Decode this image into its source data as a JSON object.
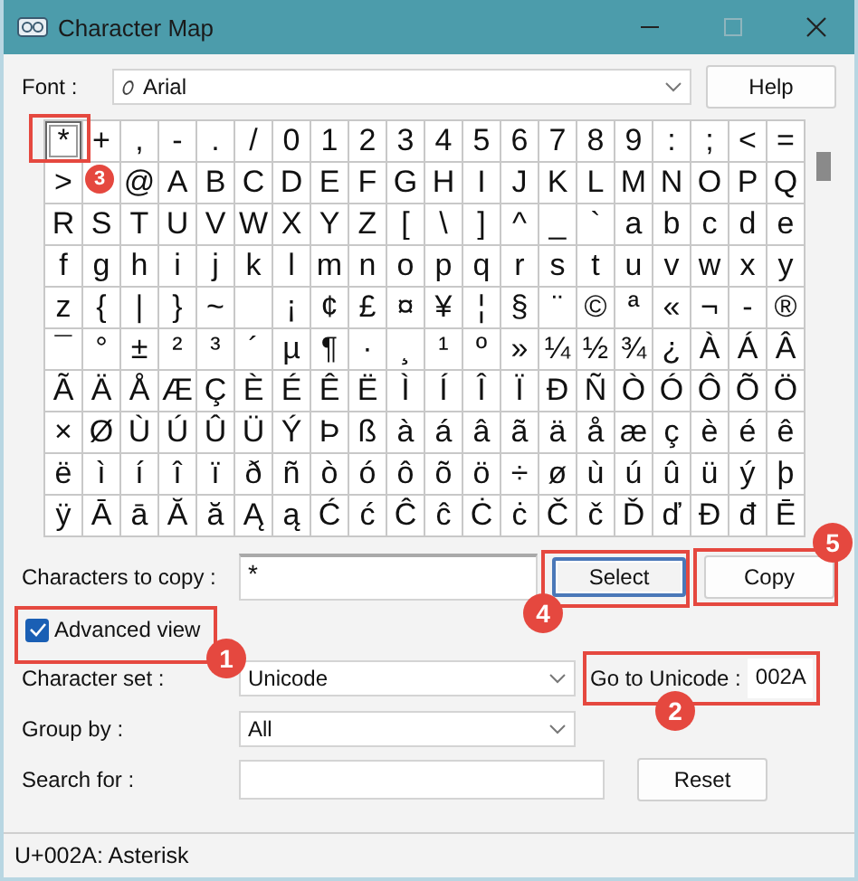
{
  "window": {
    "title": "Character Map"
  },
  "font": {
    "label": "Font :",
    "value": "Arial"
  },
  "help_button": {
    "label": "Help",
    "focused": false
  },
  "grid": [
    [
      {
        "char": "*",
        "selected": true,
        "callout": "3"
      },
      {
        "char": "+",
        "selected": false
      },
      {
        "char": ",",
        "selected": false
      },
      {
        "char": "-",
        "selected": false
      },
      {
        "char": ".",
        "selected": false
      },
      {
        "char": "/",
        "selected": false
      },
      {
        "char": "0",
        "selected": false
      },
      {
        "char": "1",
        "selected": false
      },
      {
        "char": "2",
        "selected": false
      },
      {
        "char": "3",
        "selected": false
      },
      {
        "char": "4",
        "selected": false
      },
      {
        "char": "5",
        "selected": false
      },
      {
        "char": "6",
        "selected": false
      },
      {
        "char": "7",
        "selected": false
      },
      {
        "char": "8",
        "selected": false
      },
      {
        "char": "9",
        "selected": false
      },
      {
        "char": ":",
        "selected": false
      },
      {
        "char": ";",
        "selected": false
      },
      {
        "char": "<",
        "selected": false
      },
      {
        "char": "=",
        "selected": false
      }
    ],
    [
      {
        "char": ">",
        "selected": false
      },
      {
        "selected": false
      },
      {
        "char": "@",
        "selected": false
      },
      {
        "char": "A",
        "selected": false
      },
      {
        "char": "B",
        "selected": false
      },
      {
        "char": "C",
        "selected": false
      },
      {
        "char": "D",
        "selected": false
      },
      {
        "char": "E",
        "selected": false
      },
      {
        "char": "F",
        "selected": false
      },
      {
        "char": "G",
        "selected": false
      },
      {
        "char": "H",
        "selected": false
      },
      {
        "char": "I",
        "selected": false
      },
      {
        "char": "J",
        "selected": false
      },
      {
        "char": "K",
        "selected": false
      },
      {
        "char": "L",
        "selected": false
      },
      {
        "char": "M",
        "selected": false
      },
      {
        "char": "N",
        "selected": false
      },
      {
        "char": "O",
        "selected": false
      },
      {
        "char": "P",
        "selected": false
      },
      {
        "char": "Q",
        "selected": false
      }
    ],
    [
      {
        "char": "R",
        "selected": false
      },
      {
        "char": "S",
        "selected": false
      },
      {
        "char": "T",
        "selected": false
      },
      {
        "char": "U",
        "selected": false
      },
      {
        "char": "V",
        "selected": false
      },
      {
        "char": "W",
        "selected": false
      },
      {
        "char": "X",
        "selected": false
      },
      {
        "char": "Y",
        "selected": false
      },
      {
        "char": "Z",
        "selected": false
      },
      {
        "char": "[",
        "selected": false
      },
      {
        "char": "\\",
        "selected": false
      },
      {
        "char": "]",
        "selected": false
      },
      {
        "char": "^",
        "selected": false
      },
      {
        "char": "_",
        "selected": false
      },
      {
        "char": "`",
        "selected": false
      },
      {
        "char": "a",
        "selected": false
      },
      {
        "char": "b",
        "selected": false
      },
      {
        "char": "c",
        "selected": false
      },
      {
        "char": "d",
        "selected": false
      },
      {
        "char": "e",
        "selected": false
      }
    ],
    [
      {
        "char": "f",
        "selected": false
      },
      {
        "char": "g",
        "selected": false
      },
      {
        "char": "h",
        "selected": false
      },
      {
        "char": "i",
        "selected": false
      },
      {
        "char": "j",
        "selected": false
      },
      {
        "char": "k",
        "selected": false
      },
      {
        "char": "l",
        "selected": false
      },
      {
        "char": "m",
        "selected": false
      },
      {
        "char": "n",
        "selected": false
      },
      {
        "char": "o",
        "selected": false
      },
      {
        "char": "p",
        "selected": false
      },
      {
        "char": "q",
        "selected": false
      },
      {
        "char": "r",
        "selected": false
      },
      {
        "char": "s",
        "selected": false
      },
      {
        "char": "t",
        "selected": false
      },
      {
        "char": "u",
        "selected": false
      },
      {
        "char": "v",
        "selected": false
      },
      {
        "char": "w",
        "selected": false
      },
      {
        "char": "x",
        "selected": false
      },
      {
        "char": "y",
        "selected": false
      }
    ],
    [
      {
        "char": "z",
        "selected": false
      },
      {
        "char": "{",
        "selected": false
      },
      {
        "char": "|",
        "selected": false
      },
      {
        "char": "}",
        "selected": false
      },
      {
        "char": "~",
        "selected": false
      },
      {
        "selected": false
      },
      {
        "char": "¡",
        "selected": false
      },
      {
        "char": "¢",
        "selected": false
      },
      {
        "char": "£",
        "selected": false
      },
      {
        "char": "¤",
        "selected": false
      },
      {
        "char": "¥",
        "selected": false
      },
      {
        "char": "¦",
        "selected": false
      },
      {
        "char": "§",
        "selected": false
      },
      {
        "char": "¨",
        "selected": false
      },
      {
        "char": "©",
        "selected": false
      },
      {
        "char": "ª",
        "selected": false
      },
      {
        "char": "«",
        "selected": false
      },
      {
        "char": "¬",
        "selected": false
      },
      {
        "char": "-",
        "selected": false
      },
      {
        "char": "®",
        "selected": false
      }
    ],
    [
      {
        "char": "¯",
        "selected": false
      },
      {
        "char": "°",
        "selected": false
      },
      {
        "char": "±",
        "selected": false
      },
      {
        "char": "²",
        "selected": false
      },
      {
        "char": "³",
        "selected": false
      },
      {
        "char": "´",
        "selected": false
      },
      {
        "char": "µ",
        "selected": false
      },
      {
        "char": "¶",
        "selected": false
      },
      {
        "char": "·",
        "selected": false
      },
      {
        "char": "¸",
        "selected": false
      },
      {
        "char": "¹",
        "selected": false
      },
      {
        "char": "º",
        "selected": false
      },
      {
        "char": "»",
        "selected": false
      },
      {
        "char": "¼",
        "selected": false
      },
      {
        "char": "½",
        "selected": false
      },
      {
        "char": "¾",
        "selected": false
      },
      {
        "char": "¿",
        "selected": false
      },
      {
        "char": "À",
        "selected": false
      },
      {
        "char": "Á",
        "selected": false
      },
      {
        "char": "Â",
        "selected": false
      }
    ],
    [
      {
        "char": "Ã",
        "selected": false
      },
      {
        "char": "Ä",
        "selected": false
      },
      {
        "char": "Å",
        "selected": false
      },
      {
        "char": "Æ",
        "selected": false
      },
      {
        "char": "Ç",
        "selected": false
      },
      {
        "char": "È",
        "selected": false
      },
      {
        "char": "É",
        "selected": false
      },
      {
        "char": "Ê",
        "selected": false
      },
      {
        "char": "Ë",
        "selected": false
      },
      {
        "char": "Ì",
        "selected": false
      },
      {
        "char": "Í",
        "selected": false
      },
      {
        "char": "Î",
        "selected": false
      },
      {
        "char": "Ï",
        "selected": false
      },
      {
        "char": "Ð",
        "selected": false
      },
      {
        "char": "Ñ",
        "selected": false
      },
      {
        "char": "Ò",
        "selected": false
      },
      {
        "char": "Ó",
        "selected": false
      },
      {
        "char": "Ô",
        "selected": false
      },
      {
        "char": "Õ",
        "selected": false
      },
      {
        "char": "Ö",
        "selected": false
      }
    ],
    [
      {
        "char": "×",
        "selected": false
      },
      {
        "char": "Ø",
        "selected": false
      },
      {
        "char": "Ù",
        "selected": false
      },
      {
        "char": "Ú",
        "selected": false
      },
      {
        "char": "Û",
        "selected": false
      },
      {
        "char": "Ü",
        "selected": false
      },
      {
        "char": "Ý",
        "selected": false
      },
      {
        "char": "Þ",
        "selected": false
      },
      {
        "char": "ß",
        "selected": false
      },
      {
        "char": "à",
        "selected": false
      },
      {
        "char": "á",
        "selected": false
      },
      {
        "char": "â",
        "selected": false
      },
      {
        "char": "ã",
        "selected": false
      },
      {
        "char": "ä",
        "selected": false
      },
      {
        "char": "å",
        "selected": false
      },
      {
        "char": "æ",
        "selected": false
      },
      {
        "char": "ç",
        "selected": false
      },
      {
        "char": "è",
        "selected": false
      },
      {
        "char": "é",
        "selected": false
      },
      {
        "char": "ê",
        "selected": false
      }
    ],
    [
      {
        "char": "ë",
        "selected": false
      },
      {
        "char": "ì",
        "selected": false
      },
      {
        "char": "í",
        "selected": false
      },
      {
        "char": "î",
        "selected": false
      },
      {
        "char": "ï",
        "selected": false
      },
      {
        "char": "ð",
        "selected": false
      },
      {
        "char": "ñ",
        "selected": false
      },
      {
        "char": "ò",
        "selected": false
      },
      {
        "char": "ó",
        "selected": false
      },
      {
        "char": "ô",
        "selected": false
      },
      {
        "char": "õ",
        "selected": false
      },
      {
        "char": "ö",
        "selected": false
      },
      {
        "char": "÷",
        "selected": false
      },
      {
        "char": "ø",
        "selected": false
      },
      {
        "char": "ù",
        "selected": false
      },
      {
        "char": "ú",
        "selected": false
      },
      {
        "char": "û",
        "selected": false
      },
      {
        "char": "ü",
        "selected": false
      },
      {
        "char": "ý",
        "selected": false
      },
      {
        "char": "þ",
        "selected": false
      }
    ],
    [
      {
        "char": "ÿ",
        "selected": false
      },
      {
        "char": "Ā",
        "selected": false
      },
      {
        "char": "ā",
        "selected": false
      },
      {
        "char": "Ă",
        "selected": false
      },
      {
        "char": "ă",
        "selected": false
      },
      {
        "char": "Ą",
        "selected": false
      },
      {
        "char": "ą",
        "selected": false
      },
      {
        "char": "Ć",
        "selected": false
      },
      {
        "char": "ć",
        "selected": false
      },
      {
        "char": "Ĉ",
        "selected": false
      },
      {
        "char": "ĉ",
        "selected": false
      },
      {
        "char": "Ċ",
        "selected": false
      },
      {
        "char": "ċ",
        "selected": false
      },
      {
        "char": "Č",
        "selected": false
      },
      {
        "char": "č",
        "selected": false
      },
      {
        "char": "Ď",
        "selected": false
      },
      {
        "char": "ď",
        "selected": false
      },
      {
        "char": "Đ",
        "selected": false
      },
      {
        "char": "đ",
        "selected": false
      },
      {
        "char": "Ē",
        "selected": false
      }
    ]
  ],
  "copy": {
    "label": "Characters to copy :",
    "value": "*"
  },
  "select_button": {
    "label": "Select",
    "focused": true,
    "callout": "4"
  },
  "copy_button": {
    "label": "Copy",
    "focused": false,
    "callout": "5"
  },
  "advanced_view": {
    "label": "Advanced view",
    "checked": true,
    "callout": "1"
  },
  "character_set": {
    "label": "Character set :",
    "value": "Unicode"
  },
  "go_to_unicode": {
    "label": "Go to Unicode :",
    "value": "002A",
    "callout": "2"
  },
  "group_by": {
    "label": "Group by :",
    "value": "All"
  },
  "search": {
    "label": "Search for :"
  },
  "reset_button": {
    "label": "Reset",
    "focused": false
  },
  "status_bar": "U+002A: Asterisk"
}
